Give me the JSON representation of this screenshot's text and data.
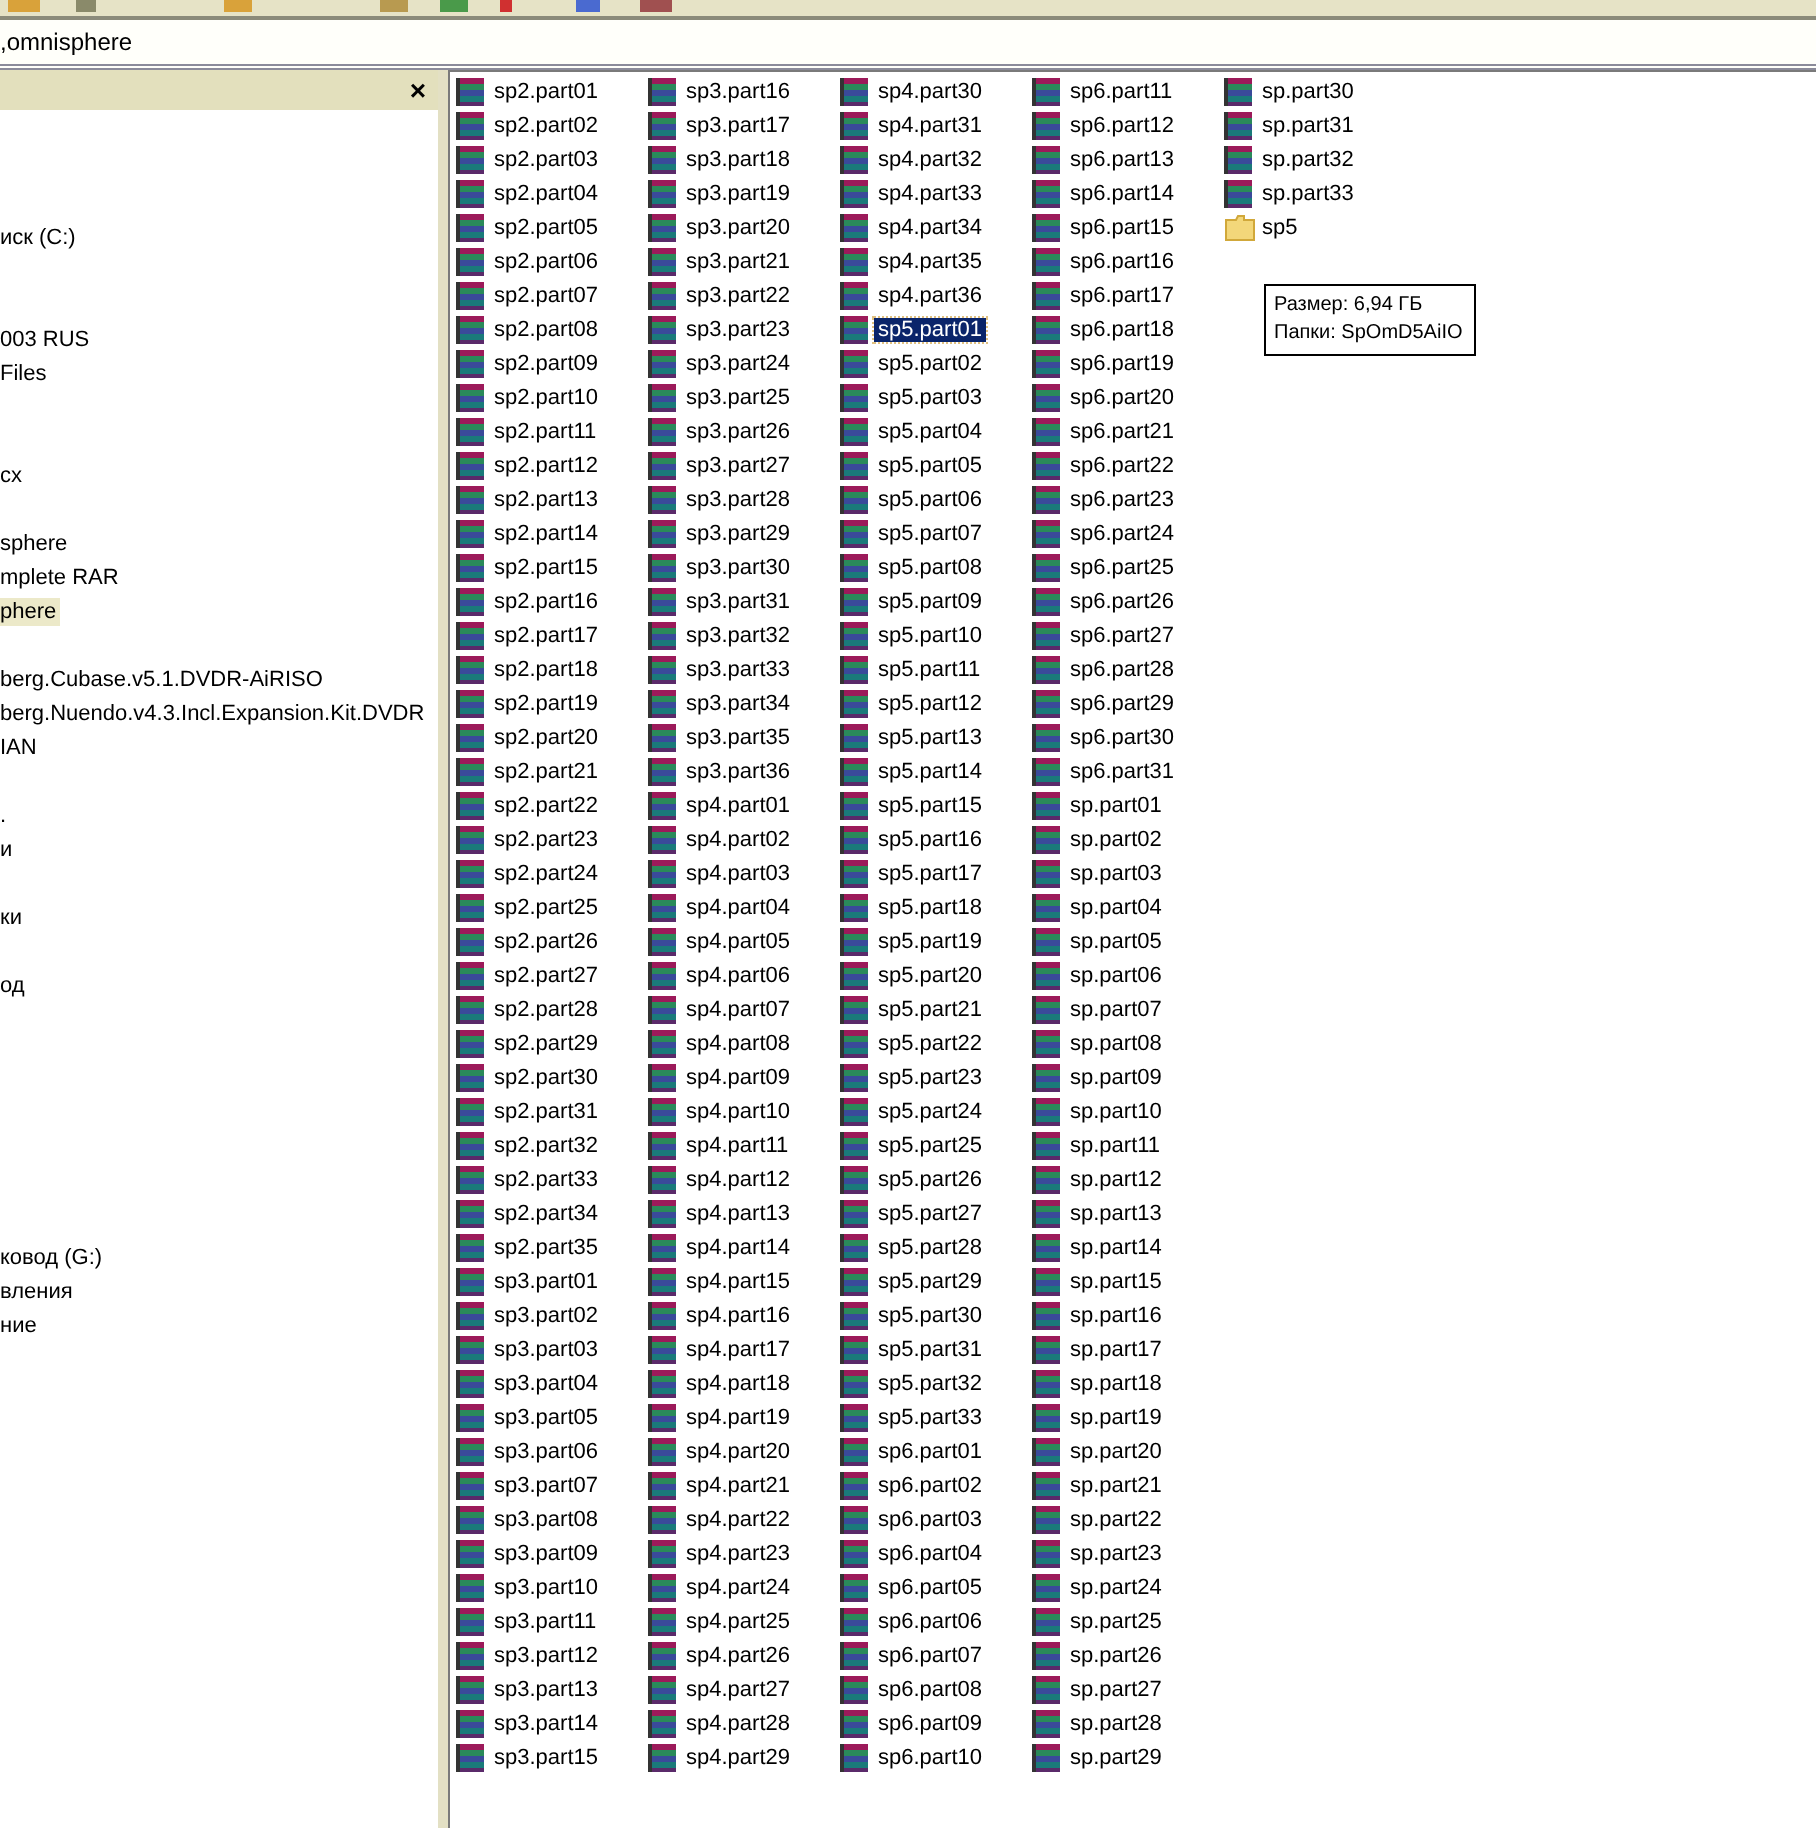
{
  "address_bar": {
    "value": ",omnisphere"
  },
  "folders_pane": {
    "close": "×",
    "items": [
      {
        "text": "иск (C:)",
        "selected": false
      },
      {
        "text": "003 RUS",
        "selected": false
      },
      {
        "text": "Files",
        "selected": false
      },
      {
        "text": "сх",
        "selected": false
      },
      {
        "text": "sphere",
        "selected": false
      },
      {
        "text": "mplete RAR",
        "selected": false
      },
      {
        "text": "phere",
        "selected": true
      },
      {
        "text": "berg.Cubase.v5.1.DVDR-AiRISO",
        "selected": false
      },
      {
        "text": "berg.Nuendo.v4.3.Incl.Expansion.Kit.DVDR",
        "selected": false
      },
      {
        "text": "IAN",
        "selected": false
      },
      {
        "text": ".",
        "selected": false
      },
      {
        "text": "и",
        "selected": false
      },
      {
        "text": "ки",
        "selected": false
      },
      {
        "text": "од",
        "selected": false
      },
      {
        "text": "ковод (G:)",
        "selected": false
      },
      {
        "text": "вления",
        "selected": false
      },
      {
        "text": "ние",
        "selected": false
      }
    ]
  },
  "files": [
    {
      "name": "sp2.part01",
      "kind": "archive",
      "selected": false
    },
    {
      "name": "sp2.part02",
      "kind": "archive",
      "selected": false
    },
    {
      "name": "sp2.part03",
      "kind": "archive",
      "selected": false
    },
    {
      "name": "sp2.part04",
      "kind": "archive",
      "selected": false
    },
    {
      "name": "sp2.part05",
      "kind": "archive",
      "selected": false
    },
    {
      "name": "sp2.part06",
      "kind": "archive",
      "selected": false
    },
    {
      "name": "sp2.part07",
      "kind": "archive",
      "selected": false
    },
    {
      "name": "sp2.part08",
      "kind": "archive",
      "selected": false
    },
    {
      "name": "sp2.part09",
      "kind": "archive",
      "selected": false
    },
    {
      "name": "sp2.part10",
      "kind": "archive",
      "selected": false
    },
    {
      "name": "sp2.part11",
      "kind": "archive",
      "selected": false
    },
    {
      "name": "sp2.part12",
      "kind": "archive",
      "selected": false
    },
    {
      "name": "sp2.part13",
      "kind": "archive",
      "selected": false
    },
    {
      "name": "sp2.part14",
      "kind": "archive",
      "selected": false
    },
    {
      "name": "sp2.part15",
      "kind": "archive",
      "selected": false
    },
    {
      "name": "sp2.part16",
      "kind": "archive",
      "selected": false
    },
    {
      "name": "sp2.part17",
      "kind": "archive",
      "selected": false
    },
    {
      "name": "sp2.part18",
      "kind": "archive",
      "selected": false
    },
    {
      "name": "sp2.part19",
      "kind": "archive",
      "selected": false
    },
    {
      "name": "sp2.part20",
      "kind": "archive",
      "selected": false
    },
    {
      "name": "sp2.part21",
      "kind": "archive",
      "selected": false
    },
    {
      "name": "sp2.part22",
      "kind": "archive",
      "selected": false
    },
    {
      "name": "sp2.part23",
      "kind": "archive",
      "selected": false
    },
    {
      "name": "sp2.part24",
      "kind": "archive",
      "selected": false
    },
    {
      "name": "sp2.part25",
      "kind": "archive",
      "selected": false
    },
    {
      "name": "sp2.part26",
      "kind": "archive",
      "selected": false
    },
    {
      "name": "sp2.part27",
      "kind": "archive",
      "selected": false
    },
    {
      "name": "sp2.part28",
      "kind": "archive",
      "selected": false
    },
    {
      "name": "sp2.part29",
      "kind": "archive",
      "selected": false
    },
    {
      "name": "sp2.part30",
      "kind": "archive",
      "selected": false
    },
    {
      "name": "sp2.part31",
      "kind": "archive",
      "selected": false
    },
    {
      "name": "sp2.part32",
      "kind": "archive",
      "selected": false
    },
    {
      "name": "sp2.part33",
      "kind": "archive",
      "selected": false
    },
    {
      "name": "sp2.part34",
      "kind": "archive",
      "selected": false
    },
    {
      "name": "sp2.part35",
      "kind": "archive",
      "selected": false
    },
    {
      "name": "sp3.part01",
      "kind": "archive",
      "selected": false
    },
    {
      "name": "sp3.part02",
      "kind": "archive",
      "selected": false
    },
    {
      "name": "sp3.part03",
      "kind": "archive",
      "selected": false
    },
    {
      "name": "sp3.part04",
      "kind": "archive",
      "selected": false
    },
    {
      "name": "sp3.part05",
      "kind": "archive",
      "selected": false
    },
    {
      "name": "sp3.part06",
      "kind": "archive",
      "selected": false
    },
    {
      "name": "sp3.part07",
      "kind": "archive",
      "selected": false
    },
    {
      "name": "sp3.part08",
      "kind": "archive",
      "selected": false
    },
    {
      "name": "sp3.part09",
      "kind": "archive",
      "selected": false
    },
    {
      "name": "sp3.part10",
      "kind": "archive",
      "selected": false
    },
    {
      "name": "sp3.part11",
      "kind": "archive",
      "selected": false
    },
    {
      "name": "sp3.part12",
      "kind": "archive",
      "selected": false
    },
    {
      "name": "sp3.part13",
      "kind": "archive",
      "selected": false
    },
    {
      "name": "sp3.part14",
      "kind": "archive",
      "selected": false
    },
    {
      "name": "sp3.part15",
      "kind": "archive",
      "selected": false
    },
    {
      "name": "sp3.part16",
      "kind": "archive",
      "selected": false
    },
    {
      "name": "sp3.part17",
      "kind": "archive",
      "selected": false
    },
    {
      "name": "sp3.part18",
      "kind": "archive",
      "selected": false
    },
    {
      "name": "sp3.part19",
      "kind": "archive",
      "selected": false
    },
    {
      "name": "sp3.part20",
      "kind": "archive",
      "selected": false
    },
    {
      "name": "sp3.part21",
      "kind": "archive",
      "selected": false
    },
    {
      "name": "sp3.part22",
      "kind": "archive",
      "selected": false
    },
    {
      "name": "sp3.part23",
      "kind": "archive",
      "selected": false
    },
    {
      "name": "sp3.part24",
      "kind": "archive",
      "selected": false
    },
    {
      "name": "sp3.part25",
      "kind": "archive",
      "selected": false
    },
    {
      "name": "sp3.part26",
      "kind": "archive",
      "selected": false
    },
    {
      "name": "sp3.part27",
      "kind": "archive",
      "selected": false
    },
    {
      "name": "sp3.part28",
      "kind": "archive",
      "selected": false
    },
    {
      "name": "sp3.part29",
      "kind": "archive",
      "selected": false
    },
    {
      "name": "sp3.part30",
      "kind": "archive",
      "selected": false
    },
    {
      "name": "sp3.part31",
      "kind": "archive",
      "selected": false
    },
    {
      "name": "sp3.part32",
      "kind": "archive",
      "selected": false
    },
    {
      "name": "sp3.part33",
      "kind": "archive",
      "selected": false
    },
    {
      "name": "sp3.part34",
      "kind": "archive",
      "selected": false
    },
    {
      "name": "sp3.part35",
      "kind": "archive",
      "selected": false
    },
    {
      "name": "sp3.part36",
      "kind": "archive",
      "selected": false
    },
    {
      "name": "sp4.part01",
      "kind": "archive",
      "selected": false
    },
    {
      "name": "sp4.part02",
      "kind": "archive",
      "selected": false
    },
    {
      "name": "sp4.part03",
      "kind": "archive",
      "selected": false
    },
    {
      "name": "sp4.part04",
      "kind": "archive",
      "selected": false
    },
    {
      "name": "sp4.part05",
      "kind": "archive",
      "selected": false
    },
    {
      "name": "sp4.part06",
      "kind": "archive",
      "selected": false
    },
    {
      "name": "sp4.part07",
      "kind": "archive",
      "selected": false
    },
    {
      "name": "sp4.part08",
      "kind": "archive",
      "selected": false
    },
    {
      "name": "sp4.part09",
      "kind": "archive",
      "selected": false
    },
    {
      "name": "sp4.part10",
      "kind": "archive",
      "selected": false
    },
    {
      "name": "sp4.part11",
      "kind": "archive",
      "selected": false
    },
    {
      "name": "sp4.part12",
      "kind": "archive",
      "selected": false
    },
    {
      "name": "sp4.part13",
      "kind": "archive",
      "selected": false
    },
    {
      "name": "sp4.part14",
      "kind": "archive",
      "selected": false
    },
    {
      "name": "sp4.part15",
      "kind": "archive",
      "selected": false
    },
    {
      "name": "sp4.part16",
      "kind": "archive",
      "selected": false
    },
    {
      "name": "sp4.part17",
      "kind": "archive",
      "selected": false
    },
    {
      "name": "sp4.part18",
      "kind": "archive",
      "selected": false
    },
    {
      "name": "sp4.part19",
      "kind": "archive",
      "selected": false
    },
    {
      "name": "sp4.part20",
      "kind": "archive",
      "selected": false
    },
    {
      "name": "sp4.part21",
      "kind": "archive",
      "selected": false
    },
    {
      "name": "sp4.part22",
      "kind": "archive",
      "selected": false
    },
    {
      "name": "sp4.part23",
      "kind": "archive",
      "selected": false
    },
    {
      "name": "sp4.part24",
      "kind": "archive",
      "selected": false
    },
    {
      "name": "sp4.part25",
      "kind": "archive",
      "selected": false
    },
    {
      "name": "sp4.part26",
      "kind": "archive",
      "selected": false
    },
    {
      "name": "sp4.part27",
      "kind": "archive",
      "selected": false
    },
    {
      "name": "sp4.part28",
      "kind": "archive",
      "selected": false
    },
    {
      "name": "sp4.part29",
      "kind": "archive",
      "selected": false
    },
    {
      "name": "sp4.part30",
      "kind": "archive",
      "selected": false
    },
    {
      "name": "sp4.part31",
      "kind": "archive",
      "selected": false
    },
    {
      "name": "sp4.part32",
      "kind": "archive",
      "selected": false
    },
    {
      "name": "sp4.part33",
      "kind": "archive",
      "selected": false
    },
    {
      "name": "sp4.part34",
      "kind": "archive",
      "selected": false
    },
    {
      "name": "sp4.part35",
      "kind": "archive",
      "selected": false
    },
    {
      "name": "sp4.part36",
      "kind": "archive",
      "selected": false
    },
    {
      "name": "sp5.part01",
      "kind": "archive",
      "selected": true
    },
    {
      "name": "sp5.part02",
      "kind": "archive",
      "selected": false
    },
    {
      "name": "sp5.part03",
      "kind": "archive",
      "selected": false
    },
    {
      "name": "sp5.part04",
      "kind": "archive",
      "selected": false
    },
    {
      "name": "sp5.part05",
      "kind": "archive",
      "selected": false
    },
    {
      "name": "sp5.part06",
      "kind": "archive",
      "selected": false
    },
    {
      "name": "sp5.part07",
      "kind": "archive",
      "selected": false
    },
    {
      "name": "sp5.part08",
      "kind": "archive",
      "selected": false
    },
    {
      "name": "sp5.part09",
      "kind": "archive",
      "selected": false
    },
    {
      "name": "sp5.part10",
      "kind": "archive",
      "selected": false
    },
    {
      "name": "sp5.part11",
      "kind": "archive",
      "selected": false
    },
    {
      "name": "sp5.part12",
      "kind": "archive",
      "selected": false
    },
    {
      "name": "sp5.part13",
      "kind": "archive",
      "selected": false
    },
    {
      "name": "sp5.part14",
      "kind": "archive",
      "selected": false
    },
    {
      "name": "sp5.part15",
      "kind": "archive",
      "selected": false
    },
    {
      "name": "sp5.part16",
      "kind": "archive",
      "selected": false
    },
    {
      "name": "sp5.part17",
      "kind": "archive",
      "selected": false
    },
    {
      "name": "sp5.part18",
      "kind": "archive",
      "selected": false
    },
    {
      "name": "sp5.part19",
      "kind": "archive",
      "selected": false
    },
    {
      "name": "sp5.part20",
      "kind": "archive",
      "selected": false
    },
    {
      "name": "sp5.part21",
      "kind": "archive",
      "selected": false
    },
    {
      "name": "sp5.part22",
      "kind": "archive",
      "selected": false
    },
    {
      "name": "sp5.part23",
      "kind": "archive",
      "selected": false
    },
    {
      "name": "sp5.part24",
      "kind": "archive",
      "selected": false
    },
    {
      "name": "sp5.part25",
      "kind": "archive",
      "selected": false
    },
    {
      "name": "sp5.part26",
      "kind": "archive",
      "selected": false
    },
    {
      "name": "sp5.part27",
      "kind": "archive",
      "selected": false
    },
    {
      "name": "sp5.part28",
      "kind": "archive",
      "selected": false
    },
    {
      "name": "sp5.part29",
      "kind": "archive",
      "selected": false
    },
    {
      "name": "sp5.part30",
      "kind": "archive",
      "selected": false
    },
    {
      "name": "sp5.part31",
      "kind": "archive",
      "selected": false
    },
    {
      "name": "sp5.part32",
      "kind": "archive",
      "selected": false
    },
    {
      "name": "sp5.part33",
      "kind": "archive",
      "selected": false
    },
    {
      "name": "sp6.part01",
      "kind": "archive",
      "selected": false
    },
    {
      "name": "sp6.part02",
      "kind": "archive",
      "selected": false
    },
    {
      "name": "sp6.part03",
      "kind": "archive",
      "selected": false
    },
    {
      "name": "sp6.part04",
      "kind": "archive",
      "selected": false
    },
    {
      "name": "sp6.part05",
      "kind": "archive",
      "selected": false
    },
    {
      "name": "sp6.part06",
      "kind": "archive",
      "selected": false
    },
    {
      "name": "sp6.part07",
      "kind": "archive",
      "selected": false
    },
    {
      "name": "sp6.part08",
      "kind": "archive",
      "selected": false
    },
    {
      "name": "sp6.part09",
      "kind": "archive",
      "selected": false
    },
    {
      "name": "sp6.part10",
      "kind": "archive",
      "selected": false
    },
    {
      "name": "sp6.part11",
      "kind": "archive",
      "selected": false
    },
    {
      "name": "sp6.part12",
      "kind": "archive",
      "selected": false
    },
    {
      "name": "sp6.part13",
      "kind": "archive",
      "selected": false
    },
    {
      "name": "sp6.part14",
      "kind": "archive",
      "selected": false
    },
    {
      "name": "sp6.part15",
      "kind": "archive",
      "selected": false
    },
    {
      "name": "sp6.part16",
      "kind": "archive",
      "selected": false
    },
    {
      "name": "sp6.part17",
      "kind": "archive",
      "selected": false
    },
    {
      "name": "sp6.part18",
      "kind": "archive",
      "selected": false
    },
    {
      "name": "sp6.part19",
      "kind": "archive",
      "selected": false
    },
    {
      "name": "sp6.part20",
      "kind": "archive",
      "selected": false
    },
    {
      "name": "sp6.part21",
      "kind": "archive",
      "selected": false
    },
    {
      "name": "sp6.part22",
      "kind": "archive",
      "selected": false
    },
    {
      "name": "sp6.part23",
      "kind": "archive",
      "selected": false
    },
    {
      "name": "sp6.part24",
      "kind": "archive",
      "selected": false
    },
    {
      "name": "sp6.part25",
      "kind": "archive",
      "selected": false
    },
    {
      "name": "sp6.part26",
      "kind": "archive",
      "selected": false
    },
    {
      "name": "sp6.part27",
      "kind": "archive",
      "selected": false
    },
    {
      "name": "sp6.part28",
      "kind": "archive",
      "selected": false
    },
    {
      "name": "sp6.part29",
      "kind": "archive",
      "selected": false
    },
    {
      "name": "sp6.part30",
      "kind": "archive",
      "selected": false
    },
    {
      "name": "sp6.part31",
      "kind": "archive",
      "selected": false
    },
    {
      "name": "sp.part01",
      "kind": "archive",
      "selected": false
    },
    {
      "name": "sp.part02",
      "kind": "archive",
      "selected": false
    },
    {
      "name": "sp.part03",
      "kind": "archive",
      "selected": false
    },
    {
      "name": "sp.part04",
      "kind": "archive",
      "selected": false
    },
    {
      "name": "sp.part05",
      "kind": "archive",
      "selected": false
    },
    {
      "name": "sp.part06",
      "kind": "archive",
      "selected": false
    },
    {
      "name": "sp.part07",
      "kind": "archive",
      "selected": false
    },
    {
      "name": "sp.part08",
      "kind": "archive",
      "selected": false
    },
    {
      "name": "sp.part09",
      "kind": "archive",
      "selected": false
    },
    {
      "name": "sp.part10",
      "kind": "archive",
      "selected": false
    },
    {
      "name": "sp.part11",
      "kind": "archive",
      "selected": false
    },
    {
      "name": "sp.part12",
      "kind": "archive",
      "selected": false
    },
    {
      "name": "sp.part13",
      "kind": "archive",
      "selected": false
    },
    {
      "name": "sp.part14",
      "kind": "archive",
      "selected": false
    },
    {
      "name": "sp.part15",
      "kind": "archive",
      "selected": false
    },
    {
      "name": "sp.part16",
      "kind": "archive",
      "selected": false
    },
    {
      "name": "sp.part17",
      "kind": "archive",
      "selected": false
    },
    {
      "name": "sp.part18",
      "kind": "archive",
      "selected": false
    },
    {
      "name": "sp.part19",
      "kind": "archive",
      "selected": false
    },
    {
      "name": "sp.part20",
      "kind": "archive",
      "selected": false
    },
    {
      "name": "sp.part21",
      "kind": "archive",
      "selected": false
    },
    {
      "name": "sp.part22",
      "kind": "archive",
      "selected": false
    },
    {
      "name": "sp.part23",
      "kind": "archive",
      "selected": false
    },
    {
      "name": "sp.part24",
      "kind": "archive",
      "selected": false
    },
    {
      "name": "sp.part25",
      "kind": "archive",
      "selected": false
    },
    {
      "name": "sp.part26",
      "kind": "archive",
      "selected": false
    },
    {
      "name": "sp.part27",
      "kind": "archive",
      "selected": false
    },
    {
      "name": "sp.part28",
      "kind": "archive",
      "selected": false
    },
    {
      "name": "sp.part29",
      "kind": "archive",
      "selected": false
    },
    {
      "name": "sp.part30",
      "kind": "archive",
      "selected": false
    },
    {
      "name": "sp.part31",
      "kind": "archive",
      "selected": false
    },
    {
      "name": "sp.part32",
      "kind": "archive",
      "selected": false
    },
    {
      "name": "sp.part33",
      "kind": "archive",
      "selected": false
    },
    {
      "name": "sp5",
      "kind": "folder",
      "selected": false
    }
  ],
  "tooltip": {
    "lines": [
      "Размер: 6,94 ГБ",
      "Папки: SpOmD5AiIO"
    ]
  }
}
